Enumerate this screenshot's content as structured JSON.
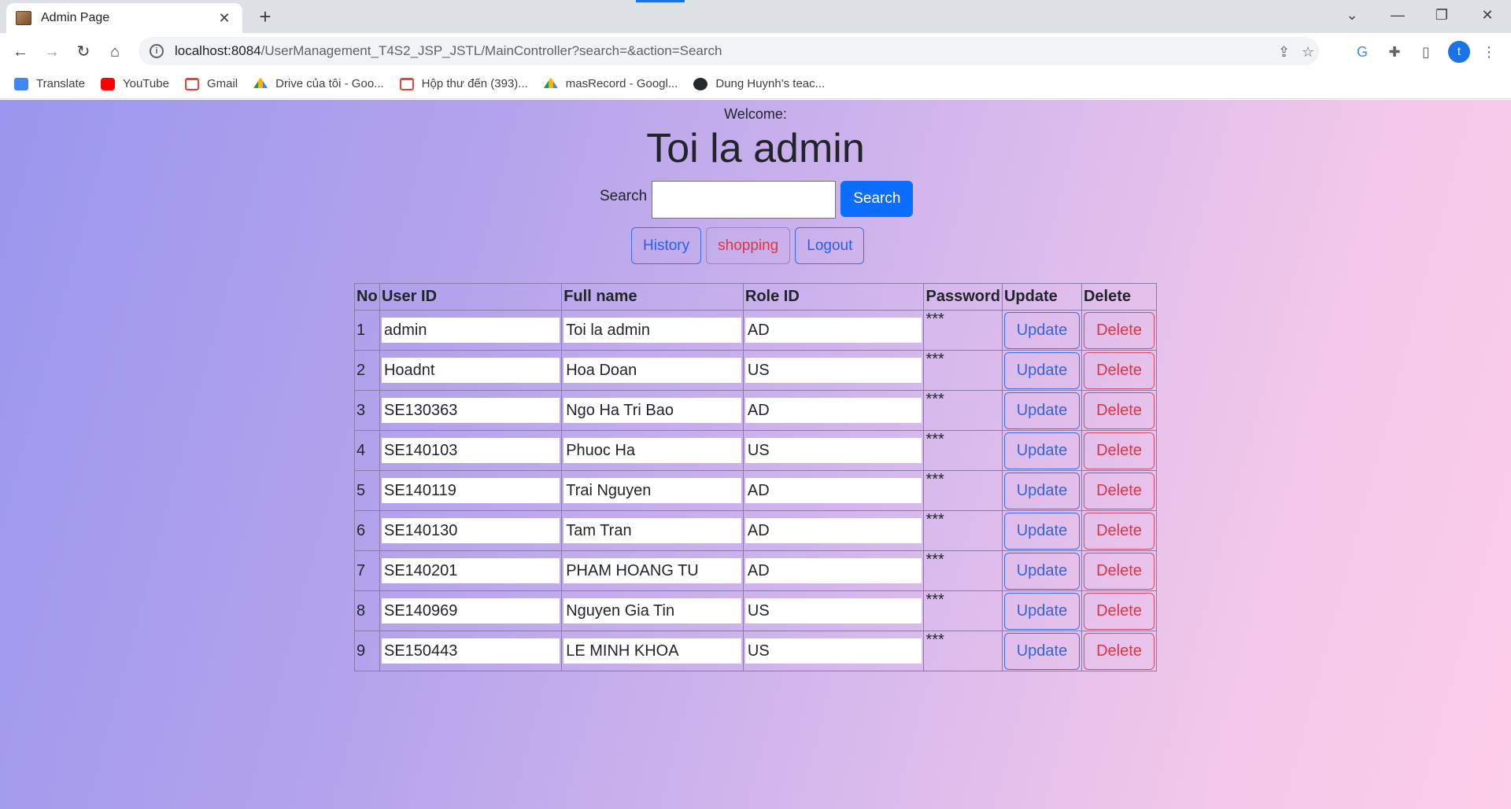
{
  "browser": {
    "tab_title": "Admin Page",
    "url_host": "localhost:8084",
    "url_path": "/UserManagement_T4S2_JSP_JSTL/MainController?search=&action=Search",
    "profile_initial": "t",
    "bookmarks": [
      {
        "label": "Translate",
        "icon": "translate-icon"
      },
      {
        "label": "YouTube",
        "icon": "youtube-icon"
      },
      {
        "label": "Gmail",
        "icon": "gmail-icon"
      },
      {
        "label": "Drive của tôi - Goo...",
        "icon": "drive-icon"
      },
      {
        "label": "Hộp thư đến (393)...",
        "icon": "gmail-icon"
      },
      {
        "label": "masRecord - Googl...",
        "icon": "drive-icon"
      },
      {
        "label": "Dung Huynh's teac...",
        "icon": "github-icon"
      }
    ]
  },
  "header": {
    "welcome": "Welcome:",
    "admin_name": "Toi la admin"
  },
  "search": {
    "label": "Search",
    "value": "",
    "button": "Search"
  },
  "nav": {
    "history": "History",
    "shopping": "shopping",
    "logout": "Logout"
  },
  "table": {
    "headers": [
      "No",
      "User ID",
      "Full name",
      "Role ID",
      "Password",
      "Update",
      "Delete"
    ],
    "update_label": "Update",
    "delete_label": "Delete",
    "rows": [
      {
        "no": "1",
        "user_id": "admin",
        "full_name": "Toi la admin",
        "role_id": "AD",
        "password": "***"
      },
      {
        "no": "2",
        "user_id": "Hoadnt",
        "full_name": "Hoa Doan",
        "role_id": "US",
        "password": "***"
      },
      {
        "no": "3",
        "user_id": "SE130363",
        "full_name": "Ngo Ha Tri Bao",
        "role_id": "AD",
        "password": "***"
      },
      {
        "no": "4",
        "user_id": "SE140103",
        "full_name": "Phuoc Ha",
        "role_id": "US",
        "password": "***"
      },
      {
        "no": "5",
        "user_id": "SE140119",
        "full_name": "Trai Nguyen",
        "role_id": "AD",
        "password": "***"
      },
      {
        "no": "6",
        "user_id": "SE140130",
        "full_name": "Tam Tran",
        "role_id": "AD",
        "password": "***"
      },
      {
        "no": "7",
        "user_id": "SE140201",
        "full_name": "PHAM HOANG TU",
        "role_id": "AD",
        "password": "***"
      },
      {
        "no": "8",
        "user_id": "SE140969",
        "full_name": "Nguyen Gia Tin",
        "role_id": "US",
        "password": "***"
      },
      {
        "no": "9",
        "user_id": "SE150443",
        "full_name": "LE MINH KHOA",
        "role_id": "US",
        "password": "***"
      }
    ]
  },
  "colors": {
    "primary": "#0d6efd",
    "danger": "#dc3545",
    "gradient_start": "#9b97ee",
    "gradient_end": "#fdcde9"
  }
}
